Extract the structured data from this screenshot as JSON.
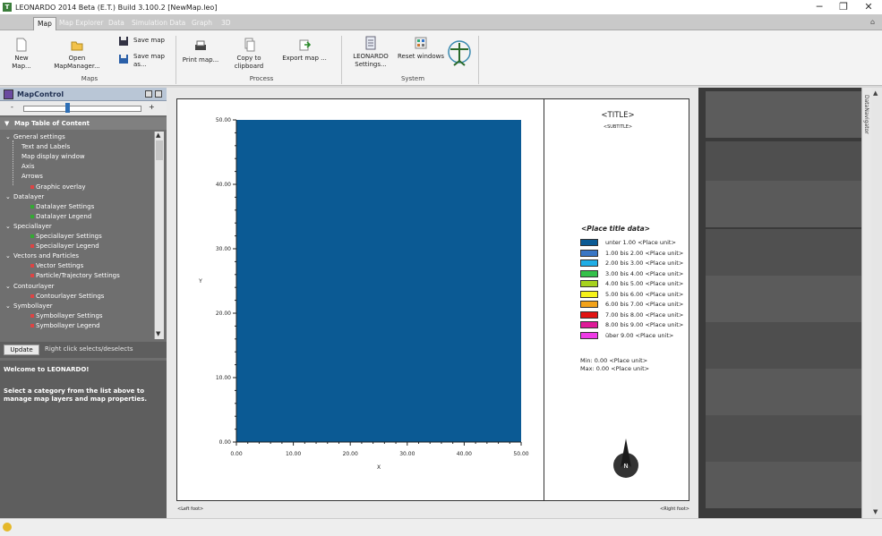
{
  "window": {
    "title": "LEONARDO 2014 Beta (E.T.) Build 3.100.2 [NewMap.leo]",
    "app_icon": "leonardo-app-icon",
    "minimize": "─",
    "restore": "❐",
    "close": "✕"
  },
  "ribbon_tabs": [
    "Map",
    "Map Explorer",
    "Data",
    "Simulation Data",
    "Graph",
    "3D"
  ],
  "ribbon": {
    "maps": {
      "label": "Maps",
      "new_map": "New Map...",
      "open_map_manager": "Open MapManager...",
      "save_map": "Save map",
      "save_map_as": "Save map as..."
    },
    "process": {
      "label": "Process",
      "print_map": "Print map...",
      "copy_to_clipboard": "Copy to clipboard",
      "export_map": "Export map ..."
    },
    "system": {
      "label": "System",
      "leonardo_settings": "LEONARDO Settings...",
      "reset_windows": "Reset windows"
    }
  },
  "map_control": {
    "title": "MapControl",
    "zoom_minus": "-",
    "zoom_plus": "+",
    "zoom_level": 0.37,
    "toc_title": "Map Table of Content",
    "tree": [
      {
        "label": "General settings",
        "level": 0,
        "expander": "v"
      },
      {
        "label": "Text and Labels",
        "level": 1
      },
      {
        "label": "Map display window",
        "level": 1
      },
      {
        "label": "Axis",
        "level": 1
      },
      {
        "label": "Arrows",
        "level": 1
      },
      {
        "label": "Graphic overlay",
        "level": 1,
        "icon": "red-x"
      },
      {
        "label": "Datalayer",
        "level": 0,
        "expander": "v"
      },
      {
        "label": "Datalayer Settings",
        "level": 1,
        "icon": "green-check"
      },
      {
        "label": "Datalayer Legend",
        "level": 1,
        "icon": "green-check"
      },
      {
        "label": "Speciallayer",
        "level": 0,
        "expander": "v"
      },
      {
        "label": "Speciallayer Settings",
        "level": 1,
        "icon": "green-check"
      },
      {
        "label": "Speciallayer Legend",
        "level": 1,
        "icon": "red-x"
      },
      {
        "label": "Vectors and Particles",
        "level": 0,
        "expander": "v"
      },
      {
        "label": "Vector Settings",
        "level": 1,
        "icon": "red-x"
      },
      {
        "label": "Particle/Trajectory Settings",
        "level": 1,
        "icon": "red-x"
      },
      {
        "label": "Contourlayer",
        "level": 0,
        "expander": "v"
      },
      {
        "label": "Contourlayer Settings",
        "level": 1,
        "icon": "red-x"
      },
      {
        "label": "Symbollayer",
        "level": 0,
        "expander": "v"
      },
      {
        "label": "Symbollayer Settings",
        "level": 1,
        "icon": "red-x"
      },
      {
        "label": "Symbollayer Legend",
        "level": 1,
        "icon": "red-x"
      }
    ],
    "update_button": "Update",
    "hint": "Right click selects/deselects",
    "welcome": "Welcome to LEONARDO!",
    "instructions": "Select a category from the list above to manage map layers and map properties."
  },
  "map": {
    "title": "<TITLE>",
    "subtitle": "<SUBTITLE>",
    "left_foot": "<Left foot>",
    "right_foot": "<Right foot>",
    "north_arrow_letter": "N",
    "legend_title": "<Place title data>",
    "legend": [
      {
        "label": "unter 1.00 <Place unit>",
        "color": "#0b5a94"
      },
      {
        "label": "1.00 bis 2.00 <Place unit>",
        "color": "#3a76c4"
      },
      {
        "label": "2.00 bis 3.00 <Place unit>",
        "color": "#20aee6"
      },
      {
        "label": "3.00 bis 4.00 <Place unit>",
        "color": "#34c04a"
      },
      {
        "label": "4.00 bis 5.00 <Place unit>",
        "color": "#a6d21e"
      },
      {
        "label": "5.00 bis 6.00 <Place unit>",
        "color": "#f6f21a"
      },
      {
        "label": "6.00 bis 7.00 <Place unit>",
        "color": "#f2a21a"
      },
      {
        "label": "7.00 bis 8.00 <Place unit>",
        "color": "#e11414"
      },
      {
        "label": "8.00 bis 9.00 <Place unit>",
        "color": "#de1a98"
      },
      {
        "label": "über 9.00 <Place unit>",
        "color": "#ee3ae6"
      }
    ],
    "min_label": "Min: 0.00 <Place unit>",
    "max_label": "Max: 0.00 <Place unit>",
    "datanavigator_label": "DataNavigator"
  },
  "chart_data": {
    "type": "heatmap",
    "xlabel": "X",
    "ylabel": "Y",
    "xlim": [
      0,
      50
    ],
    "ylim": [
      0,
      50
    ],
    "xticks": [
      "0.00",
      "10.00",
      "20.00",
      "30.00",
      "40.00",
      "50.00"
    ],
    "yticks": [
      "0.00",
      "10.00",
      "20.00",
      "30.00",
      "40.00",
      "50.00"
    ],
    "fill_color": "#0b5a94",
    "value_range": [
      0,
      0
    ]
  }
}
